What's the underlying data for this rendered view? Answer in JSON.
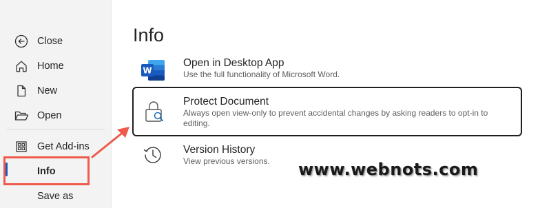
{
  "sidebar": {
    "items": [
      {
        "label": "Close",
        "icon": "back-circle-icon"
      },
      {
        "label": "Home",
        "icon": "home-icon"
      },
      {
        "label": "New",
        "icon": "new-document-icon"
      },
      {
        "label": "Open",
        "icon": "folder-open-icon"
      },
      {
        "label": "Get Add-ins",
        "icon": "add-ins-grid-icon"
      },
      {
        "label": "Info",
        "icon": ""
      },
      {
        "label": "Save as",
        "icon": ""
      }
    ],
    "selected": "Info"
  },
  "main": {
    "title": "Info",
    "options": [
      {
        "title": "Open in Desktop App",
        "description": "Use the full functionality of Microsoft Word.",
        "icon": "word-app-icon"
      },
      {
        "title": "Protect Document",
        "description": "Always open view-only to prevent accidental changes by asking readers to opt-in to editing.",
        "icon": "lock-search-icon"
      },
      {
        "title": "Version History",
        "description": "View previous versions.",
        "icon": "history-clock-icon"
      }
    ]
  },
  "watermark": "www.webnots.com",
  "colors": {
    "accent": "#185abd",
    "highlight": "#ee5a4b",
    "word_blue": "#185abd"
  }
}
